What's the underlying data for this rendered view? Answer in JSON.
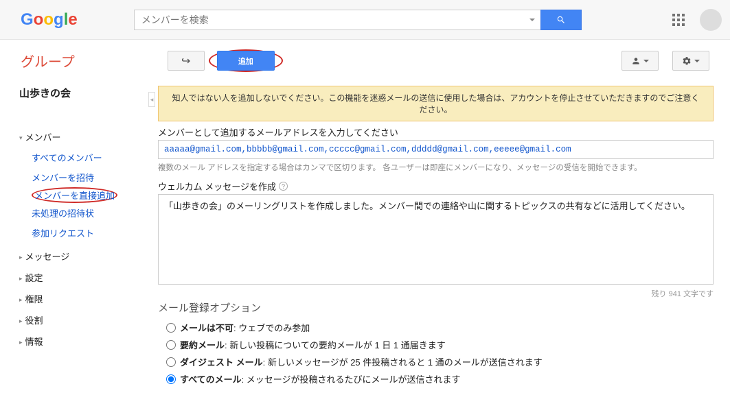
{
  "header": {
    "search_placeholder": "メンバーを検索"
  },
  "service_name": "グループ",
  "toolbar": {
    "add_label": "追加"
  },
  "group_title": "山歩きの会",
  "sidebar": {
    "members_head": "メンバー",
    "members": [
      "すべてのメンバー",
      "メンバーを招待",
      "メンバーを直接追加",
      "未処理の招待状",
      "参加リクエスト"
    ],
    "messages_head": "メッセージ",
    "settings_head": "設定",
    "perm_head": "権限",
    "roles_head": "役割",
    "info_head": "情報"
  },
  "main": {
    "notice": "知人ではない人を追加しないでください。この機能を迷惑メールの送信に使用した場合は、アカウントを停止させていただきますのでご注意ください。",
    "email_label": "メンバーとして追加するメールアドレスを入力してください",
    "email_value": "aaaaa@gmail.com,bbbbb@gmail.com,ccccc@gmail.com,ddddd@gmail.com,eeeee@gmail.com",
    "email_hint": "複数のメール アドレスを指定する場合はカンマで区切ります。 各ユーザーは即座にメンバーになり、メッセージの受信を開始できます。",
    "welcome_label": "ウェルカム メッセージを作成",
    "welcome_value": "「山歩きの会」のメーリングリストを作成しました。メンバー間での連絡や山に関するトピックスの共有などに活用してください。",
    "charcount": "残り 941 文字です",
    "opt_title": "メール登録オプション",
    "radios": [
      {
        "bold": "メールは不可",
        "rest": ": ウェブでのみ参加"
      },
      {
        "bold": "要約メール",
        "rest": ": 新しい投稿についての要約メールが 1 日 1 通届きます"
      },
      {
        "bold": "ダイジェスト メール",
        "rest": ": 新しいメッセージが 25 件投稿されると 1 通のメールが送信されます"
      },
      {
        "bold": "すべてのメール",
        "rest": ": メッセージが投稿されるたびにメールが送信されます"
      }
    ]
  }
}
